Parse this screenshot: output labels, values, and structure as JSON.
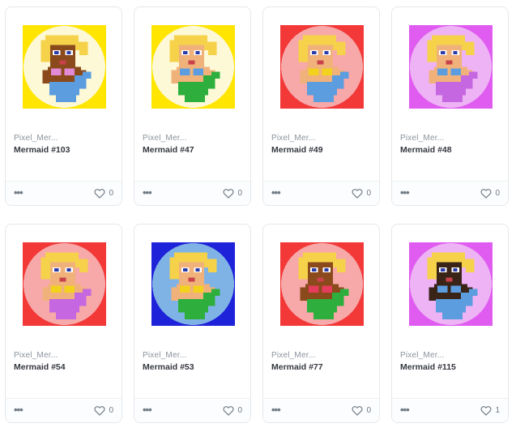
{
  "cards": [
    {
      "collection": "Pixel_Mer...",
      "name": "Mermaid #103",
      "likes": "0",
      "colors": {
        "bg": "#ffe500",
        "circle": "#fdf8d6",
        "skin": "#8b4a1c",
        "tail": "#5b9ddf",
        "top": "#e28ad6"
      }
    },
    {
      "collection": "Pixel_Mer...",
      "name": "Mermaid #47",
      "likes": "0",
      "colors": {
        "bg": "#ffe500",
        "circle": "#fdf8d6",
        "skin": "#f0b27a",
        "tail": "#2eae3d",
        "top": "#5b9ddf"
      }
    },
    {
      "collection": "Pixel_Mer...",
      "name": "Mermaid #49",
      "likes": "0",
      "colors": {
        "bg": "#f33838",
        "circle": "#f7a8a8",
        "skin": "#f0b27a",
        "tail": "#5b9ddf",
        "top": "#f2d21d"
      }
    },
    {
      "collection": "Pixel_Mer...",
      "name": "Mermaid #48",
      "likes": "0",
      "colors": {
        "bg": "#e05cf0",
        "circle": "#eeb3f5",
        "skin": "#f0b27a",
        "tail": "#c567e0",
        "top": "#5b9ddf"
      }
    },
    {
      "collection": "Pixel_Mer...",
      "name": "Mermaid #54",
      "likes": "0",
      "colors": {
        "bg": "#f33838",
        "circle": "#f7a8a8",
        "skin": "#f0b27a",
        "tail": "#c567e0",
        "top": "#f2d21d"
      }
    },
    {
      "collection": "Pixel_Mer...",
      "name": "Mermaid #53",
      "likes": "0",
      "colors": {
        "bg": "#1e22d8",
        "circle": "#7fb3e6",
        "skin": "#f0b27a",
        "tail": "#2eae3d",
        "top": "#f2d21d"
      }
    },
    {
      "collection": "Pixel_Mer...",
      "name": "Mermaid #77",
      "likes": "0",
      "colors": {
        "bg": "#f33838",
        "circle": "#f7a8a8",
        "skin": "#8b4a1c",
        "tail": "#2eae3d",
        "top": "#e53b5c"
      }
    },
    {
      "collection": "Pixel_Mer...",
      "name": "Mermaid #115",
      "likes": "1",
      "colors": {
        "bg": "#e05cf0",
        "circle": "#eeb3f5",
        "skin": "#3a2418",
        "tail": "#5b9ddf",
        "top": "#5b9ddf"
      }
    }
  ],
  "icons": {
    "more": "more-dots-icon",
    "like": "heart-icon"
  },
  "more_glyph": "•••"
}
